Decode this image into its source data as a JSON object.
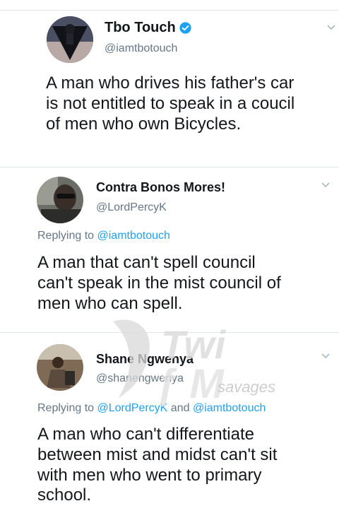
{
  "tweets": [
    {
      "display_name": "Tbo Touch",
      "handle": "@iamtbotouch",
      "verified": true,
      "replying_prefix": "",
      "text_lines": [
        "A man who drives his father's car",
        "is not entitled to speak in a coucil",
        "of men who own Bicycles."
      ]
    },
    {
      "display_name": "Contra Bonos Mores!",
      "handle": "@LordPercyK",
      "verified": false,
      "replying_prefix": "Replying to",
      "replying_to": "@iamtbotouch",
      "text_lines": [
        "A man that can't spell council",
        "can't speak in the mist council of",
        "men who can spell."
      ]
    },
    {
      "display_name": "Shane Ngwenya",
      "handle": "@shanengwenya",
      "verified": false,
      "replying_prefix": "Replying to",
      "replying_to": "@LordPercyK",
      "replying_and": "and",
      "replying_to_2": "@iamtbotouch",
      "text_lines": [
        "A man who can't differentiate",
        "between mist and midst can't sit",
        "with men who went to primary",
        "school."
      ]
    }
  ],
  "watermark": {
    "text": "savages"
  },
  "colors": {
    "link": "#1da1f2",
    "muted": "#657786",
    "verified": "#1da1f2"
  }
}
